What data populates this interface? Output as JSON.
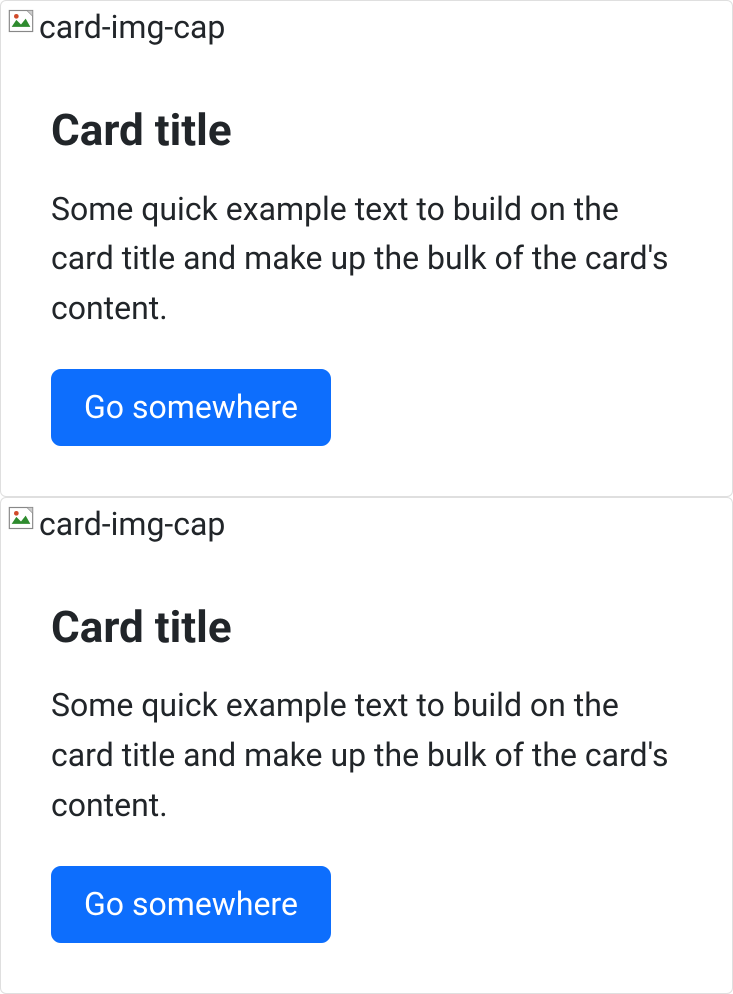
{
  "cards": [
    {
      "image_alt": "card-img-cap",
      "title": "Card title",
      "text": "Some quick example text to build on the card title and make up the bulk of the card's content.",
      "button_label": "Go somewhere"
    },
    {
      "image_alt": "card-img-cap",
      "title": "Card title",
      "text": "Some quick example text to build on the card title and make up the bulk of the card's content.",
      "button_label": "Go somewhere"
    }
  ],
  "colors": {
    "primary": "#0d6efd",
    "text": "#212529",
    "border": "rgba(0,0,0,.125)"
  }
}
